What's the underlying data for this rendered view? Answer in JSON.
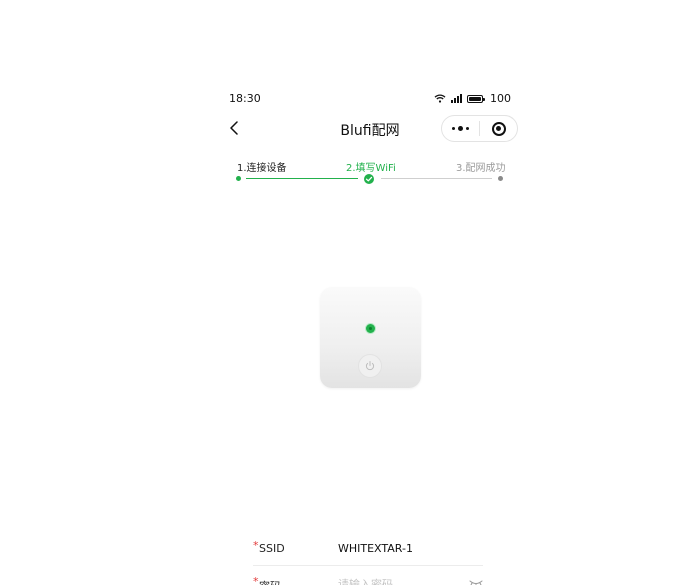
{
  "status_bar": {
    "time": "18:30",
    "battery": "100"
  },
  "nav": {
    "title": "Blufi配网"
  },
  "steps": [
    "1.连接设备",
    "2.填写WiFi",
    "3.配网成功"
  ],
  "steps_progress": {
    "current": 2,
    "total": 3
  },
  "colors": {
    "accent": "#22b14c",
    "required": "#e23b3b",
    "inactive": "#9a9a9a"
  },
  "form": {
    "ssid_required": "*",
    "ssid_label": "SSID",
    "ssid_value": "WHITEXTAR-1",
    "password_required": "*",
    "password_label": "密码",
    "password_placeholder": "请输入密码"
  },
  "icons": [
    "wifi-icon",
    "signal-icon",
    "battery-icon",
    "back-arrow-icon",
    "more-dots-icon",
    "close-target-icon",
    "check-icon",
    "power-icon",
    "eye-closed-icon"
  ]
}
